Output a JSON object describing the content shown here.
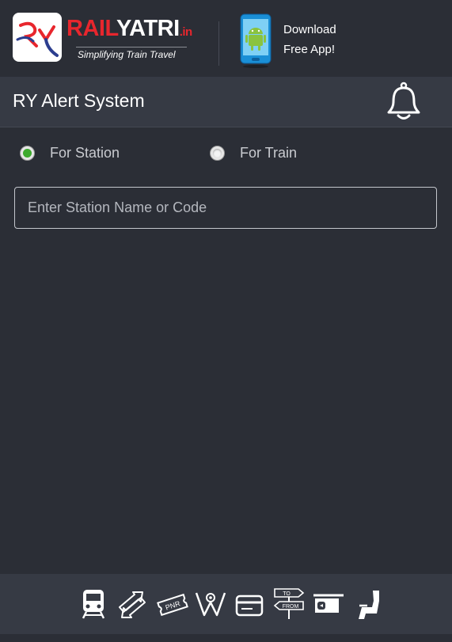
{
  "header": {
    "brand_rail": "RAIL",
    "brand_yatri": "YATRI",
    "brand_tld": ".in",
    "tagline": "Simplifying Train Travel",
    "download_line1": "Download",
    "download_line2": "Free App!"
  },
  "titlebar": {
    "title": "RY Alert System"
  },
  "search_mode": {
    "options": [
      {
        "label": "For Station",
        "selected": true
      },
      {
        "label": "For Train",
        "selected": false
      }
    ]
  },
  "search": {
    "placeholder": "Enter Station Name or Code",
    "value": ""
  },
  "bottom_nav": {
    "icons": [
      "train-icon",
      "swap-arrows-icon",
      "pnr-ticket-icon",
      "map-pin-icon",
      "card-icon",
      "to-from-signpost-icon",
      "station-board-icon",
      "seat-icon"
    ],
    "pnr_text": "PNR",
    "to_text": "TO",
    "from_text": "FROM"
  },
  "colors": {
    "background": "#2b2e36",
    "bar": "#363a44",
    "brand_red": "#e8262d",
    "radio_green": "#3daa2d"
  }
}
